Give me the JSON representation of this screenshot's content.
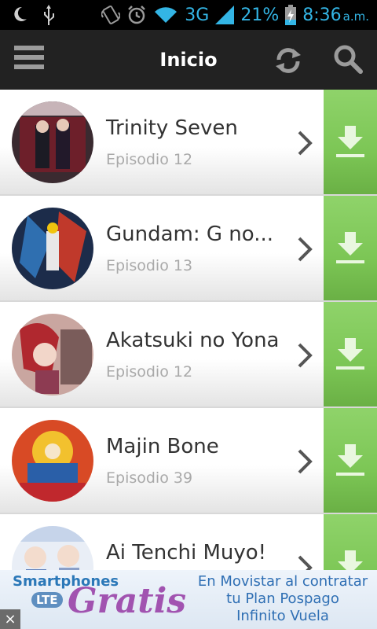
{
  "status_bar": {
    "network": "3G",
    "battery": "21%",
    "time": "8:36",
    "time_suffix": "a.m."
  },
  "appbar": {
    "title": "Inicio"
  },
  "list": {
    "items": [
      {
        "title": "Trinity Seven",
        "episode": "Episodio 12"
      },
      {
        "title": "Gundam: G no...",
        "episode": "Episodio 13"
      },
      {
        "title": "Akatsuki no Yona",
        "episode": "Episodio 12"
      },
      {
        "title": "Majin Bone",
        "episode": "Episodio 39"
      },
      {
        "title": "Ai Tenchi Muyo!",
        "episode": ""
      }
    ]
  },
  "ad": {
    "headline": "Smartphones",
    "badge": "LTE",
    "big": "Gratis",
    "line1": "En Movistar al contratar",
    "line2": "tu Plan Pospago",
    "line3": "Infinito Vuela",
    "close": "×"
  },
  "colors": {
    "appbar": "#222222",
    "accent_blue": "#33b5e5",
    "download_green": "#7cc655"
  }
}
